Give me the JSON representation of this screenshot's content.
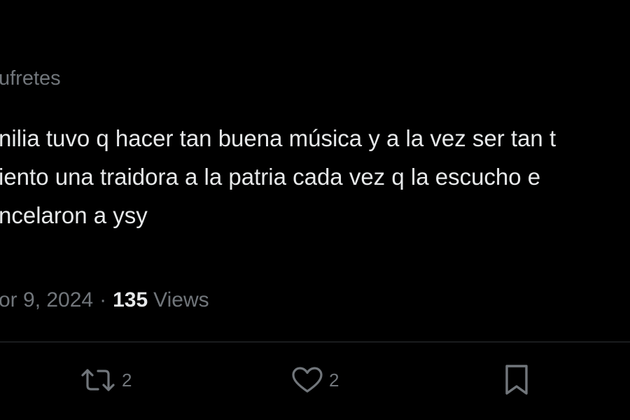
{
  "post": {
    "handle": "ufretes",
    "text_lines": [
      "nilia tuvo q hacer tan buena música y a la vez ser tan t",
      "iento una traidora a la patria cada vez q la escucho e",
      "ncelaron a ysy"
    ],
    "date": "or 9, 2024",
    "separator": "·",
    "views_count": "135",
    "views_label": "Views"
  },
  "actions": {
    "retweet": {
      "icon": "retweet-icon",
      "count": "2"
    },
    "like": {
      "icon": "heart-icon",
      "count": "2"
    },
    "bookmark": {
      "icon": "bookmark-icon"
    }
  },
  "colors": {
    "background": "#000000",
    "text_primary": "#e7e9ea",
    "text_secondary": "#71767b",
    "divider": "#2f3336"
  }
}
